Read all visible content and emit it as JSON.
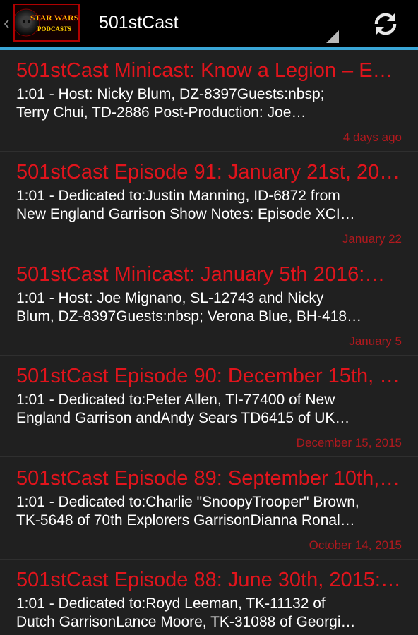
{
  "actionbar": {
    "logo_text_line1": "STAR WARS",
    "logo_text_line2": "PODCASTS",
    "title": "501stCast",
    "refresh_icon": "refresh-icon",
    "up_icon": "chevron-left-icon"
  },
  "colors": {
    "accent_bar": "#3aa6d6",
    "title_red": "#e1141c",
    "date_red": "#b0191e",
    "background": "#202020"
  },
  "episodes": [
    {
      "title": "501stCast Minicast: Know a Legion – E…",
      "desc_line1": "1:01 - Host: Nicky Blum, DZ-8397Guests:nbsp;",
      "desc_line2": "Terry Chui, TD-2886 Post-Production: Joe…",
      "date": "4 days ago"
    },
    {
      "title": "501stCast Episode 91: January 21st, 20…",
      "desc_line1": "1:01 - Dedicated to:Justin Manning, ID-6872 from",
      "desc_line2": "New England Garrison Show Notes: Episode XCI…",
      "date": "January 22"
    },
    {
      "title": "501stCast Minicast: January 5th 2016:…",
      "desc_line1": "1:01 - Host: Joe Mignano, SL-12743 and Nicky",
      "desc_line2": "Blum, DZ-8397Guests:nbsp; Verona Blue, BH-418…",
      "date": "January 5"
    },
    {
      "title": "501stCast Episode 90: December 15th, …",
      "desc_line1": "1:01 - Dedicated to:Peter Allen, TI-77400 of New",
      "desc_line2": "England Garrison andAndy Sears TD6415 of UK…",
      "date": "December 15, 2015"
    },
    {
      "title": "501stCast Episode 89: September 10th,…",
      "desc_line1": "1:01 - Dedicated to:Charlie \"SnoopyTrooper\" Brown,",
      "desc_line2": "TK-5648 of 70th Explorers GarrisonDianna Ronal…",
      "date": "October 14, 2015"
    },
    {
      "title": "501stCast Episode 88: June 30th, 2015: …",
      "desc_line1": "1:01 - Dedicated to:Royd Leeman, TK-11132 of",
      "desc_line2": "Dutch GarrisonLance Moore, TK-31088 of Georgi…",
      "date": ""
    }
  ]
}
